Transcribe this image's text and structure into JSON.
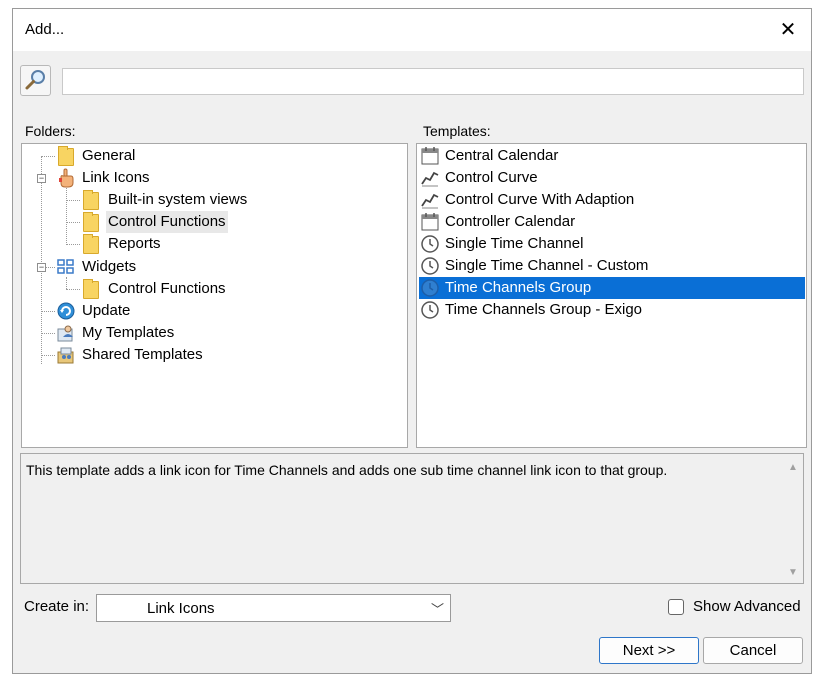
{
  "window": {
    "title": "Add...",
    "close_icon": "close-icon"
  },
  "search": {
    "value": "",
    "icon": "magnifier-icon"
  },
  "folders": {
    "label": "Folders:",
    "items": [
      {
        "label": "General",
        "icon": "folder-icon"
      },
      {
        "label": "Link Icons",
        "icon": "link-hand-icon"
      },
      {
        "label": "Built-in system views",
        "icon": "folder-icon"
      },
      {
        "label": "Control Functions",
        "icon": "folder-icon",
        "selected": true
      },
      {
        "label": "Reports",
        "icon": "folder-icon"
      },
      {
        "label": "Widgets",
        "icon": "widgets-grid-icon"
      },
      {
        "label": "Control Functions",
        "icon": "folder-icon"
      },
      {
        "label": "Update",
        "icon": "update-icon"
      },
      {
        "label": "My Templates",
        "icon": "user-templates-icon"
      },
      {
        "label": "Shared Templates",
        "icon": "shared-templates-icon"
      }
    ]
  },
  "templates": {
    "label": "Templates:",
    "items": [
      {
        "label": "Central Calendar",
        "icon": "calendar-icon"
      },
      {
        "label": "Control Curve",
        "icon": "curve-icon"
      },
      {
        "label": "Control Curve With Adaption",
        "icon": "curve-icon"
      },
      {
        "label": "Controller Calendar",
        "icon": "calendar-icon"
      },
      {
        "label": "Single Time Channel",
        "icon": "clock-icon"
      },
      {
        "label": "Single Time Channel - Custom",
        "icon": "clock-icon"
      },
      {
        "label": "Time Channels Group",
        "icon": "clock-icon",
        "selected": true
      },
      {
        "label": "Time Channels Group - Exigo",
        "icon": "clock-icon"
      }
    ]
  },
  "description": "This template adds a link icon for Time Channels and adds one sub time channel link icon to that group.",
  "create_in": {
    "label": "Create in:",
    "value": "Link Icons"
  },
  "show_advanced": {
    "label": "Show Advanced",
    "checked": false
  },
  "buttons": {
    "next": "Next >>",
    "cancel": "Cancel"
  },
  "colors": {
    "selection": "#0a6fd6",
    "folder": "#f8d462",
    "dialog_bg": "#f0f0f0"
  }
}
